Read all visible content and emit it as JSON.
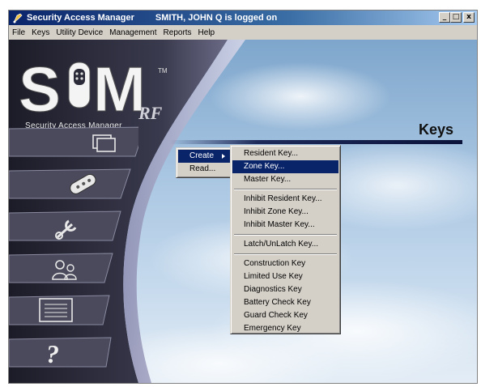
{
  "window": {
    "title": "Security Access Manager",
    "logged_on": "SMITH, JOHN Q is logged on",
    "controls": {
      "minimize": "_",
      "maximize": "□",
      "close": "x"
    }
  },
  "menubar": [
    "File",
    "Keys",
    "Utility Device",
    "Management",
    "Reports",
    "Help"
  ],
  "logo": {
    "letters": "SIM",
    "tm": "TM",
    "rf": "RF",
    "tagline": "Security Access Manager"
  },
  "nav": [
    {
      "icon": "folders-icon"
    },
    {
      "icon": "key-fob-icon"
    },
    {
      "icon": "wrench-icon"
    },
    {
      "icon": "users-icon"
    },
    {
      "icon": "list-icon"
    },
    {
      "icon": "help-icon",
      "glyph": "?"
    }
  ],
  "page": {
    "title": "Keys"
  },
  "keys_menu": {
    "items": [
      {
        "label": "Create",
        "active": true
      },
      {
        "label": "Read..."
      }
    ]
  },
  "create_menu": {
    "groups": [
      [
        "Resident Key...",
        "Zone Key...",
        "Master Key..."
      ],
      [
        "Inhibit Resident Key...",
        "Inhibit Zone Key...",
        "Inhibit Master Key..."
      ],
      [
        "Latch/UnLatch Key..."
      ],
      [
        "Construction Key",
        "Limited Use Key",
        "Diagnostics Key",
        "Battery Check Key",
        "Guard Check Key",
        "Emergency Key"
      ]
    ],
    "highlighted": "Zone Key..."
  },
  "colors": {
    "titlebar": "#0a246a",
    "highlight": "#0a246a",
    "panel_dark": "#2a2a38"
  }
}
